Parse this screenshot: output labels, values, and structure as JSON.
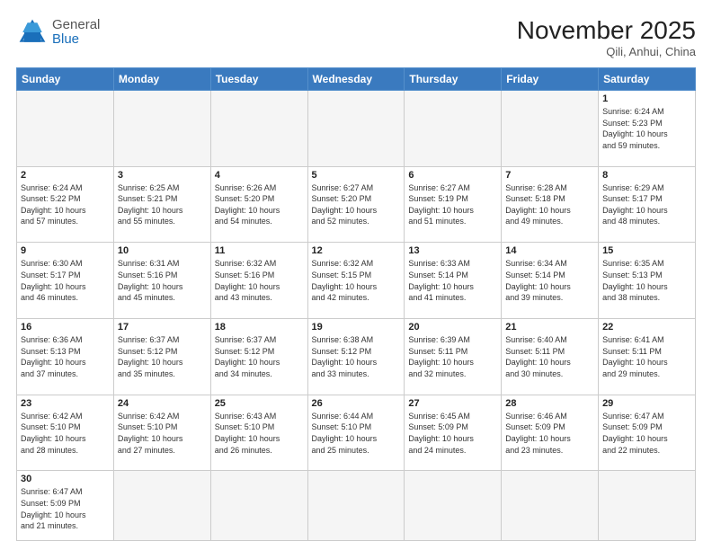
{
  "header": {
    "logo_general": "General",
    "logo_blue": "Blue",
    "month_title": "November 2025",
    "location": "Qili, Anhui, China"
  },
  "weekdays": [
    "Sunday",
    "Monday",
    "Tuesday",
    "Wednesday",
    "Thursday",
    "Friday",
    "Saturday"
  ],
  "weeks": [
    [
      {
        "day": "",
        "info": ""
      },
      {
        "day": "",
        "info": ""
      },
      {
        "day": "",
        "info": ""
      },
      {
        "day": "",
        "info": ""
      },
      {
        "day": "",
        "info": ""
      },
      {
        "day": "",
        "info": ""
      },
      {
        "day": "1",
        "info": "Sunrise: 6:24 AM\nSunset: 5:23 PM\nDaylight: 10 hours\nand 59 minutes."
      }
    ],
    [
      {
        "day": "2",
        "info": "Sunrise: 6:24 AM\nSunset: 5:22 PM\nDaylight: 10 hours\nand 57 minutes."
      },
      {
        "day": "3",
        "info": "Sunrise: 6:25 AM\nSunset: 5:21 PM\nDaylight: 10 hours\nand 55 minutes."
      },
      {
        "day": "4",
        "info": "Sunrise: 6:26 AM\nSunset: 5:20 PM\nDaylight: 10 hours\nand 54 minutes."
      },
      {
        "day": "5",
        "info": "Sunrise: 6:27 AM\nSunset: 5:20 PM\nDaylight: 10 hours\nand 52 minutes."
      },
      {
        "day": "6",
        "info": "Sunrise: 6:27 AM\nSunset: 5:19 PM\nDaylight: 10 hours\nand 51 minutes."
      },
      {
        "day": "7",
        "info": "Sunrise: 6:28 AM\nSunset: 5:18 PM\nDaylight: 10 hours\nand 49 minutes."
      },
      {
        "day": "8",
        "info": "Sunrise: 6:29 AM\nSunset: 5:17 PM\nDaylight: 10 hours\nand 48 minutes."
      }
    ],
    [
      {
        "day": "9",
        "info": "Sunrise: 6:30 AM\nSunset: 5:17 PM\nDaylight: 10 hours\nand 46 minutes."
      },
      {
        "day": "10",
        "info": "Sunrise: 6:31 AM\nSunset: 5:16 PM\nDaylight: 10 hours\nand 45 minutes."
      },
      {
        "day": "11",
        "info": "Sunrise: 6:32 AM\nSunset: 5:16 PM\nDaylight: 10 hours\nand 43 minutes."
      },
      {
        "day": "12",
        "info": "Sunrise: 6:32 AM\nSunset: 5:15 PM\nDaylight: 10 hours\nand 42 minutes."
      },
      {
        "day": "13",
        "info": "Sunrise: 6:33 AM\nSunset: 5:14 PM\nDaylight: 10 hours\nand 41 minutes."
      },
      {
        "day": "14",
        "info": "Sunrise: 6:34 AM\nSunset: 5:14 PM\nDaylight: 10 hours\nand 39 minutes."
      },
      {
        "day": "15",
        "info": "Sunrise: 6:35 AM\nSunset: 5:13 PM\nDaylight: 10 hours\nand 38 minutes."
      }
    ],
    [
      {
        "day": "16",
        "info": "Sunrise: 6:36 AM\nSunset: 5:13 PM\nDaylight: 10 hours\nand 37 minutes."
      },
      {
        "day": "17",
        "info": "Sunrise: 6:37 AM\nSunset: 5:12 PM\nDaylight: 10 hours\nand 35 minutes."
      },
      {
        "day": "18",
        "info": "Sunrise: 6:37 AM\nSunset: 5:12 PM\nDaylight: 10 hours\nand 34 minutes."
      },
      {
        "day": "19",
        "info": "Sunrise: 6:38 AM\nSunset: 5:12 PM\nDaylight: 10 hours\nand 33 minutes."
      },
      {
        "day": "20",
        "info": "Sunrise: 6:39 AM\nSunset: 5:11 PM\nDaylight: 10 hours\nand 32 minutes."
      },
      {
        "day": "21",
        "info": "Sunrise: 6:40 AM\nSunset: 5:11 PM\nDaylight: 10 hours\nand 30 minutes."
      },
      {
        "day": "22",
        "info": "Sunrise: 6:41 AM\nSunset: 5:11 PM\nDaylight: 10 hours\nand 29 minutes."
      }
    ],
    [
      {
        "day": "23",
        "info": "Sunrise: 6:42 AM\nSunset: 5:10 PM\nDaylight: 10 hours\nand 28 minutes."
      },
      {
        "day": "24",
        "info": "Sunrise: 6:42 AM\nSunset: 5:10 PM\nDaylight: 10 hours\nand 27 minutes."
      },
      {
        "day": "25",
        "info": "Sunrise: 6:43 AM\nSunset: 5:10 PM\nDaylight: 10 hours\nand 26 minutes."
      },
      {
        "day": "26",
        "info": "Sunrise: 6:44 AM\nSunset: 5:10 PM\nDaylight: 10 hours\nand 25 minutes."
      },
      {
        "day": "27",
        "info": "Sunrise: 6:45 AM\nSunset: 5:09 PM\nDaylight: 10 hours\nand 24 minutes."
      },
      {
        "day": "28",
        "info": "Sunrise: 6:46 AM\nSunset: 5:09 PM\nDaylight: 10 hours\nand 23 minutes."
      },
      {
        "day": "29",
        "info": "Sunrise: 6:47 AM\nSunset: 5:09 PM\nDaylight: 10 hours\nand 22 minutes."
      }
    ],
    [
      {
        "day": "30",
        "info": "Sunrise: 6:47 AM\nSunset: 5:09 PM\nDaylight: 10 hours\nand 21 minutes."
      },
      {
        "day": "",
        "info": ""
      },
      {
        "day": "",
        "info": ""
      },
      {
        "day": "",
        "info": ""
      },
      {
        "day": "",
        "info": ""
      },
      {
        "day": "",
        "info": ""
      },
      {
        "day": "",
        "info": ""
      }
    ]
  ]
}
